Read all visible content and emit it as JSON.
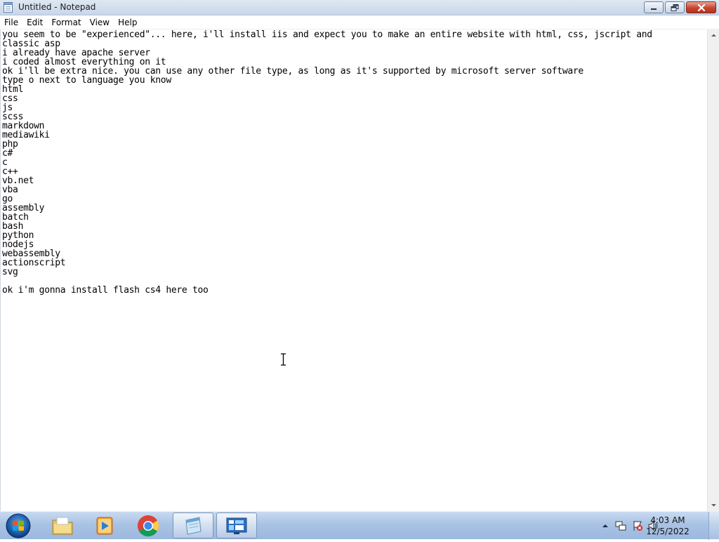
{
  "window": {
    "title": "Untitled - Notepad",
    "icon": "notepad-icon",
    "buttons": [
      "minimize-icon",
      "restore-icon",
      "close-icon"
    ]
  },
  "menu": [
    "File",
    "Edit",
    "Format",
    "View",
    "Help"
  ],
  "editor": {
    "lines": [
      "you seem to be \"experienced\"... here, i'll install iis and expect you to make an entire website with html, css, jscript and",
      "classic asp",
      "i already have apache server",
      "i coded almost everything on it",
      "ok i'll be extra nice. you can use any other file type, as long as it's supported by microsoft server software",
      "type o next to language you know",
      "html",
      "css",
      "js",
      "scss",
      "markdown",
      "mediawiki",
      "php",
      "c#",
      "c",
      "c++",
      "vb.net",
      "vba",
      "go",
      "assembly",
      "batch",
      "bash",
      "python",
      "nodejs",
      "webassembly",
      "actionscript",
      "svg",
      "",
      "ok i'm gonna install flash cs4 here too"
    ]
  },
  "taskbar": {
    "start": "windows-start-orb",
    "pinned": [
      "file-explorer-icon",
      "media-player-icon",
      "chrome-icon",
      "notepad-icon",
      "control-panel-icon"
    ],
    "tray": [
      "show-hidden-icons-arrow",
      "network-icon",
      "action-center-icon",
      "volume-icon"
    ],
    "time": "4:03 AM",
    "date": "12/5/2022"
  }
}
